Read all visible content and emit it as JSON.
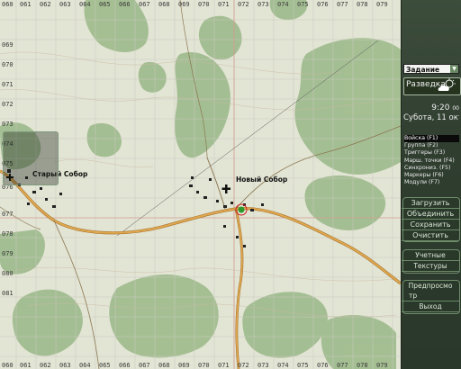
{
  "map": {
    "grid_top": [
      "060",
      "061",
      "062",
      "063",
      "064",
      "065",
      "066",
      "067",
      "068",
      "069",
      "070",
      "071",
      "072",
      "073",
      "074",
      "075",
      "076",
      "077",
      "078",
      "079"
    ],
    "grid_bottom": [
      "060",
      "061",
      "062",
      "063",
      "064",
      "065",
      "066",
      "067",
      "068",
      "069",
      "070",
      "071",
      "072",
      "073",
      "074",
      "075",
      "076",
      "077",
      "078",
      "079"
    ],
    "grid_left": [
      "069",
      "070",
      "071",
      "072",
      "073",
      "074",
      "075",
      "076",
      "077",
      "078",
      "079",
      "080",
      "081"
    ],
    "places": {
      "old_sobor": "Старый Собор",
      "new_sobor": "Новый Собор"
    },
    "colors": {
      "paper": "#e2e4d4",
      "forest": "#9ab88a",
      "road": "#c8913f",
      "grid": "#bfbfbf",
      "grid_major": "#d07c6d"
    }
  },
  "panel": {
    "mode_select": "Задание",
    "recon_label": "Разведка",
    "weather_icon": "cloud-sun-icon",
    "time": "9:20",
    "seconds": "00",
    "date": "Субота, 11 окт",
    "modes": [
      "Войска (F1)",
      "Группа (F2)",
      "Триггеры (F3)",
      "Марш. точки (F4)",
      "Синхрониз. (F5)",
      "Маркеры (F6)",
      "Модули (F7)"
    ],
    "file_buttons": [
      "Загрузить",
      "Объединить",
      "Сохранить",
      "Очистить"
    ],
    "extra_buttons": [
      "Учетные",
      "Текстуры"
    ],
    "preview_buttons": [
      "Предпросмо",
      "тр",
      "Выход"
    ]
  }
}
